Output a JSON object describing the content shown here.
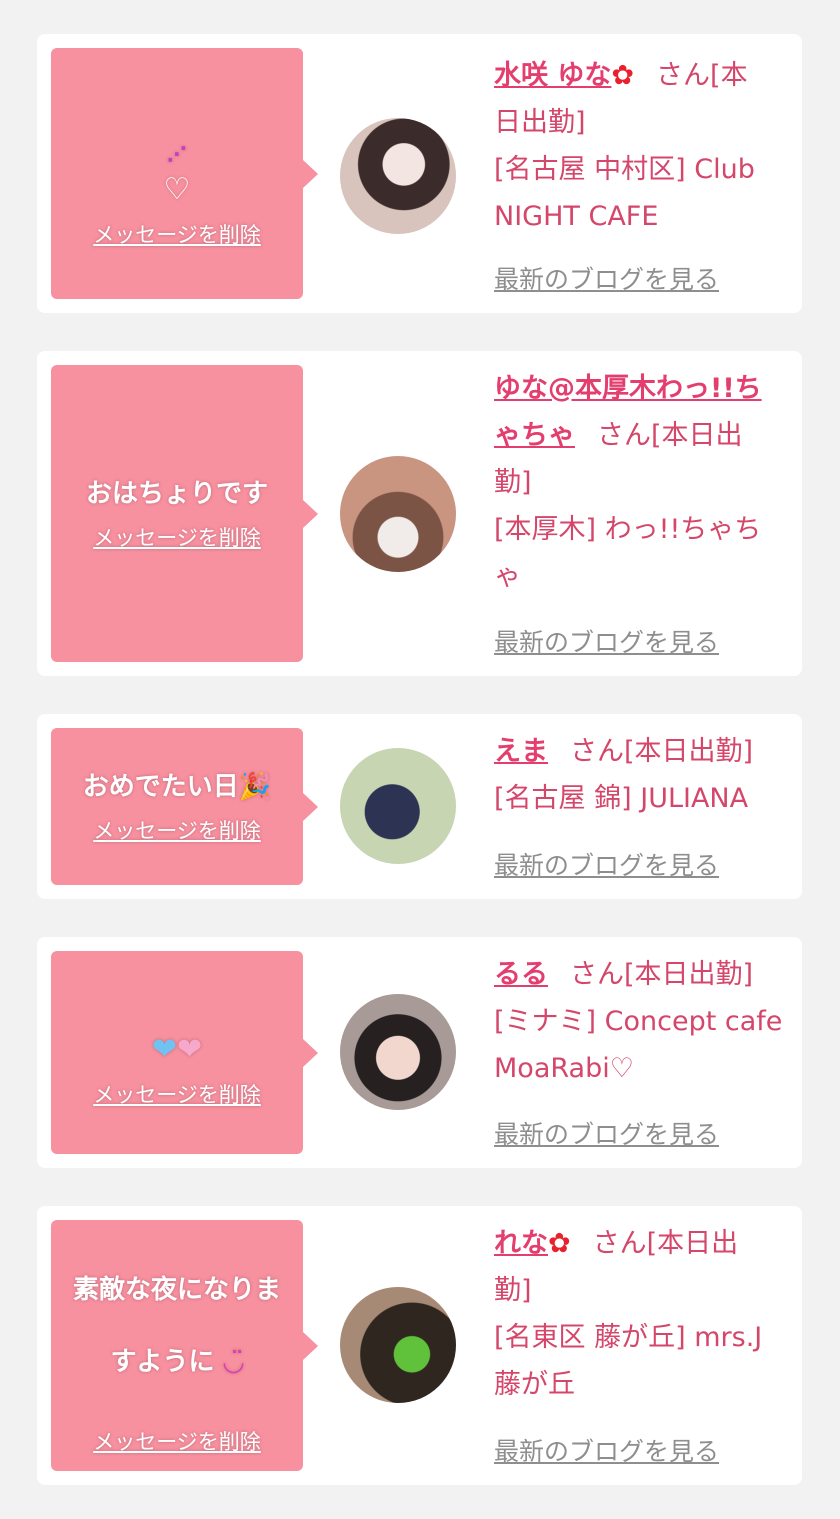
{
  "cards": [
    {
      "message_emoji": "⋰ ♡",
      "delete_label": "メッセージを削除",
      "name": "水咲 ゆな",
      "name_flower": "✿",
      "status_line1": "さん[本",
      "status_line2": "日出勤]",
      "shop_line1": "[名古屋 中村区] Club",
      "shop_line2": "NIGHT CAFE",
      "blog_label": "最新のブログを見る"
    },
    {
      "message": "おはちょりです",
      "delete_label": "メッセージを削除",
      "name_line1": "ゆな@本厚木わっ!!ち",
      "name_line2": "ゃちゃ",
      "status_line1": "さん[本日出",
      "status_line2": "勤]",
      "shop_line1": "[本厚木] わっ!!ちゃち",
      "shop_line2": "ゃ",
      "blog_label": "最新のブログを見る"
    },
    {
      "message": "おめでたい日",
      "message_emoji": "🎉",
      "delete_label": "メッセージを削除",
      "name": "えま",
      "status": "さん[本日出勤]",
      "shop_line1": "[名古屋 錦] JULIANA",
      "blog_label": "最新のブログを見る"
    },
    {
      "message_emoji": "💙💗",
      "delete_label": "メッセージを削除",
      "name": "るる",
      "status": "さん[本日出勤]",
      "shop_line1": "[ミナミ] Concept cafe",
      "shop_line2": "MoaRabi♡",
      "blog_label": "最新のブログを見る"
    },
    {
      "message_line1": "素敵な夜になりま",
      "message_line2": "すように",
      "message_emoji": "◡̈",
      "delete_label": "メッセージを削除",
      "name": "れな",
      "name_flower": "✿",
      "status_line1": "さん[本日出",
      "status_line2": "勤]",
      "shop_line1": "[名東区 藤が丘] mrs.J",
      "shop_line2": "藤が丘",
      "blog_label": "最新のブログを見る"
    }
  ],
  "colors": {
    "bubble": "#f7909f",
    "name": "#e43e6e",
    "text": "#d4466a",
    "blog": "#8e8e8e",
    "background": "#f2f2f2"
  }
}
